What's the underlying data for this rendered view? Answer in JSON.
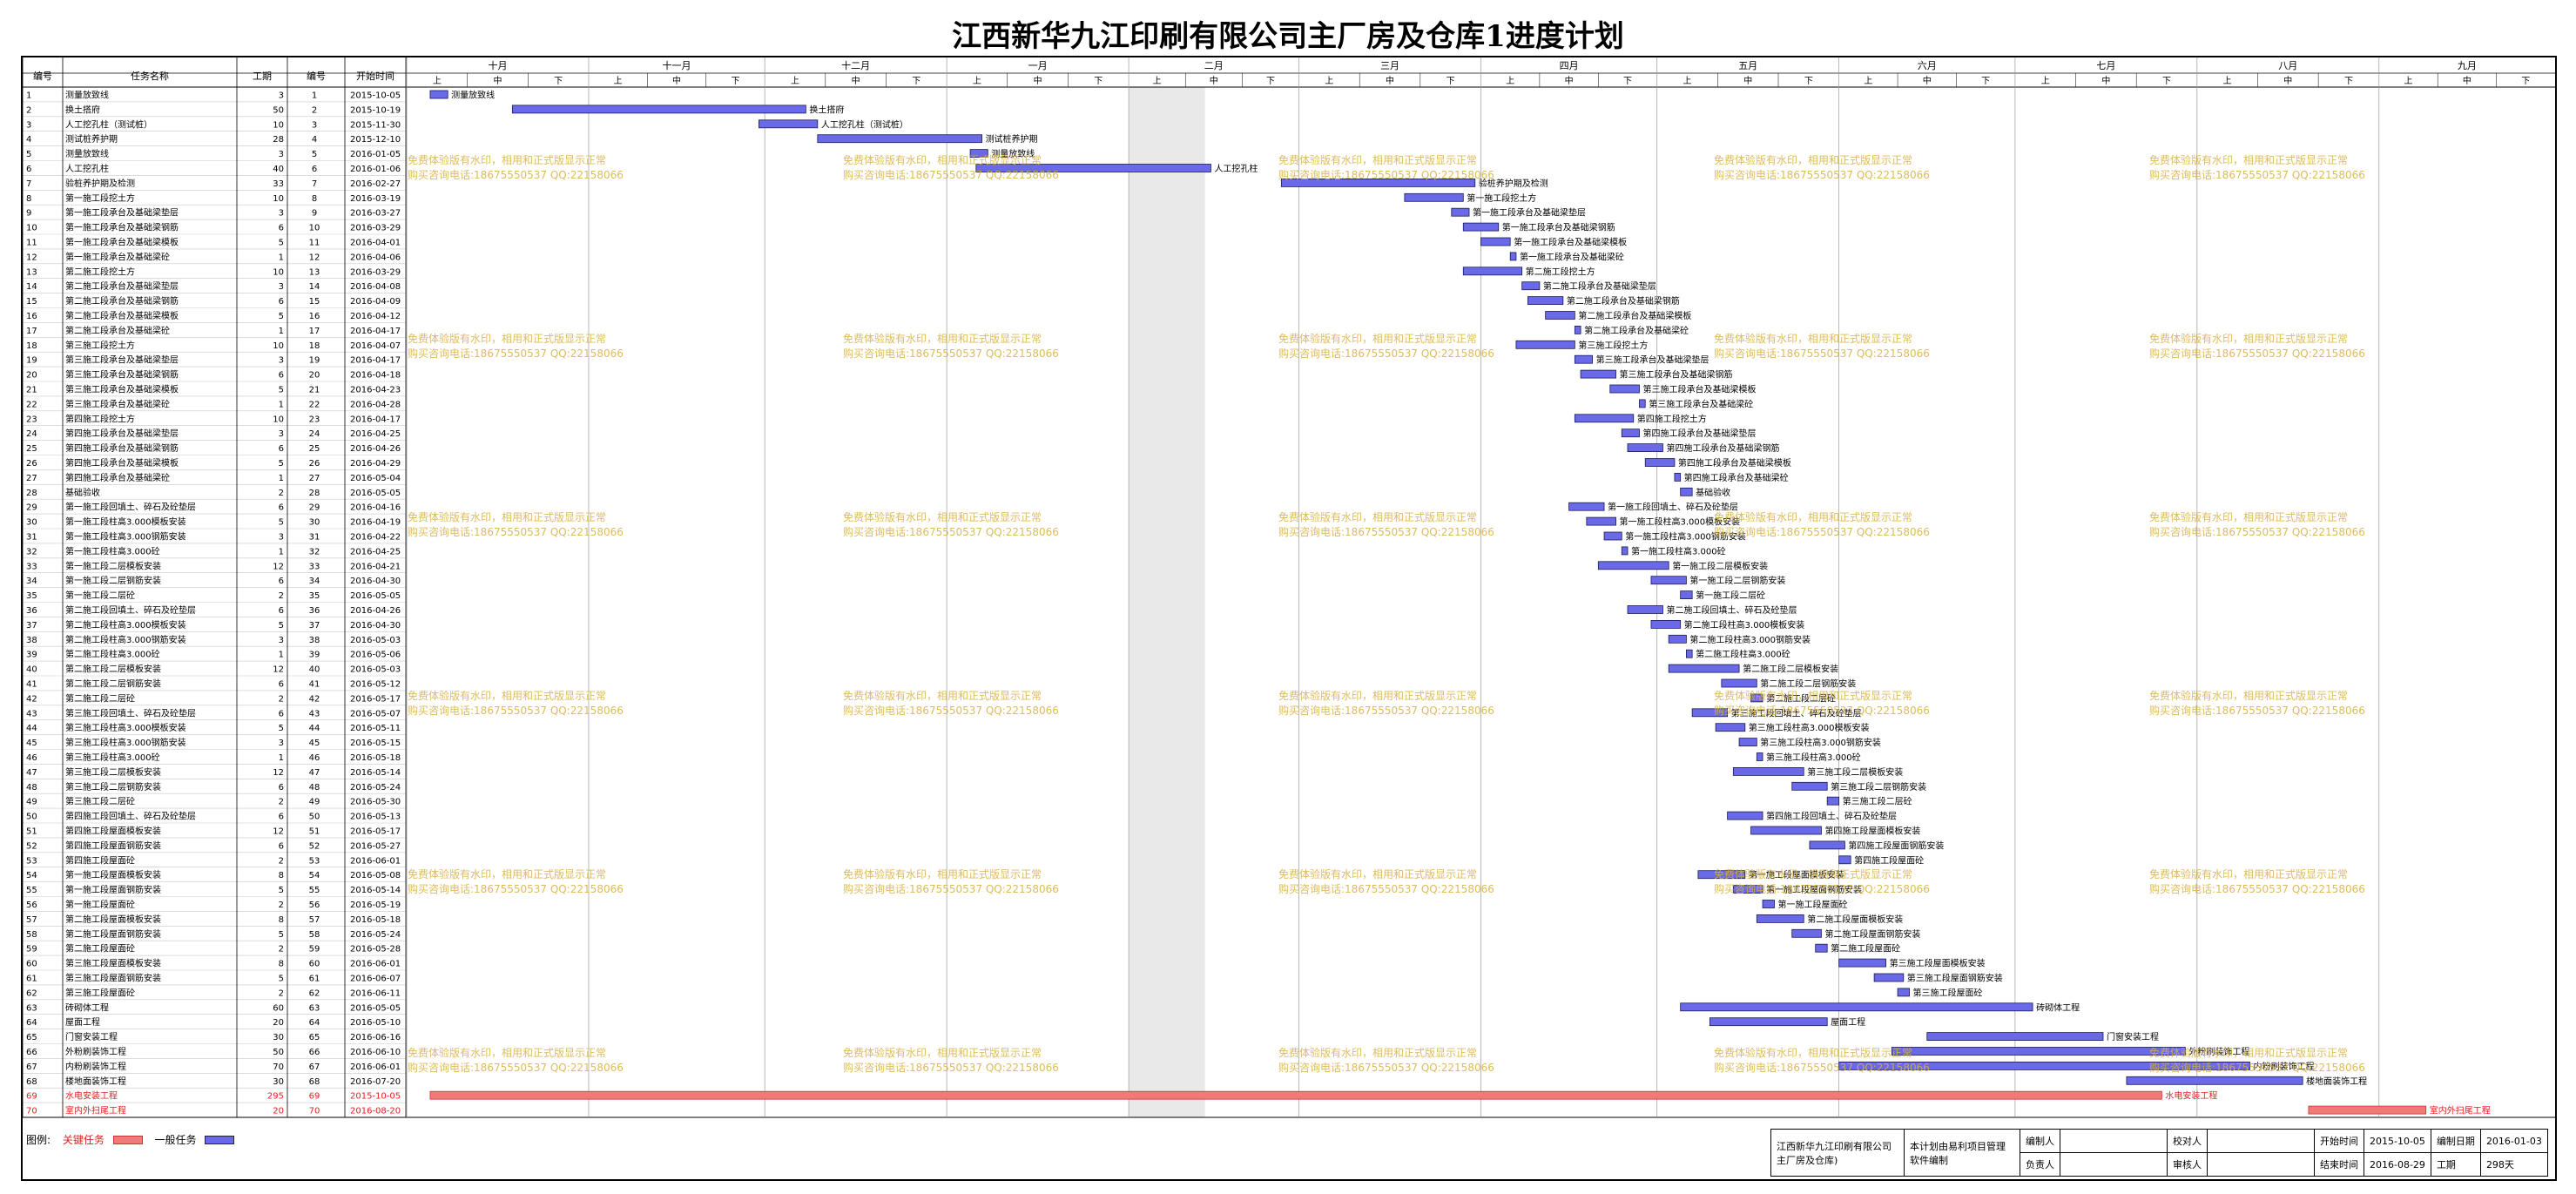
{
  "title": "江西新华九江印刷有限公司主厂房及仓库1进度计划",
  "headers": {
    "no": "编号",
    "name": "任务名称",
    "dur": "工期",
    "id": "编号",
    "start": "开始时间"
  },
  "months": [
    "十月",
    "十一月",
    "十二月",
    "一月",
    "二月",
    "三月",
    "四月",
    "五月",
    "六月",
    "七月",
    "八月",
    "九月"
  ],
  "periods": [
    "上",
    "下",
    "中"
  ],
  "watermark": {
    "line1": "免费体验版有水印，相用和正式版显示正常",
    "line2": "购买咨询电话:18675550537 QQ:22158066"
  },
  "legend": {
    "label": "图例:",
    "critical": "关键任务",
    "normal": "一般任务",
    "critical_color": "#f07a78",
    "normal_color": "#6a6ae8"
  },
  "info": {
    "company": "江西新华九江印刷有限公司主厂房及仓库)",
    "tool": "本计划由易利项目管理软件编制",
    "prepared_by": "编制人",
    "checked_by": "校对人",
    "owner": "负责人",
    "reviewer": "审核人",
    "start_label": "开始时间",
    "start": "2015-10-05",
    "date_label": "编制日期",
    "date": "2016-01-03",
    "end_label": "结束时间",
    "end": "2016-08-29",
    "dur_label": "工期",
    "dur": "298天"
  },
  "chart_data": {
    "type": "gantt",
    "title": "江西新华九江印刷有限公司主厂房及仓库1进度计划",
    "x_start": "2015-10-01",
    "x_end": "2016-09-30",
    "tasks": [
      {
        "no": "1",
        "name": "测量放致线",
        "dur": "3",
        "id": "1",
        "start": "2015-10-05"
      },
      {
        "no": "2",
        "name": "换土搭府",
        "dur": "50",
        "id": "2",
        "start": "2015-10-19"
      },
      {
        "no": "3",
        "name": "人工挖孔柱（测试桩）",
        "dur": "10",
        "id": "3",
        "start": "2015-11-30"
      },
      {
        "no": "4",
        "name": "测试桩养护期",
        "dur": "28",
        "id": "4",
        "start": "2015-12-10"
      },
      {
        "no": "5",
        "name": "测量放致线",
        "dur": "3",
        "id": "5",
        "start": "2016-01-05"
      },
      {
        "no": "6",
        "name": "人工挖孔柱",
        "dur": "40",
        "id": "6",
        "start": "2016-01-06"
      },
      {
        "no": "7",
        "name": "验桩养护期及检测",
        "dur": "33",
        "id": "7",
        "start": "2016-02-27"
      },
      {
        "no": "8",
        "name": "第一施工段挖土方",
        "dur": "10",
        "id": "8",
        "start": "2016-03-19"
      },
      {
        "no": "9",
        "name": "第一施工段承台及基础梁垫层",
        "dur": "3",
        "id": "9",
        "start": "2016-03-27"
      },
      {
        "no": "10",
        "name": "第一施工段承台及基础梁钢筋",
        "dur": "6",
        "id": "10",
        "start": "2016-03-29"
      },
      {
        "no": "11",
        "name": "第一施工段承台及基础梁模板",
        "dur": "5",
        "id": "11",
        "start": "2016-04-01"
      },
      {
        "no": "12",
        "name": "第一施工段承台及基础梁砼",
        "dur": "1",
        "id": "12",
        "start": "2016-04-06"
      },
      {
        "no": "13",
        "name": "第二施工段挖土方",
        "dur": "10",
        "id": "13",
        "start": "2016-03-29"
      },
      {
        "no": "14",
        "name": "第二施工段承台及基础梁垫层",
        "dur": "3",
        "id": "14",
        "start": "2016-04-08"
      },
      {
        "no": "15",
        "name": "第二施工段承台及基础梁钢筋",
        "dur": "6",
        "id": "15",
        "start": "2016-04-09"
      },
      {
        "no": "16",
        "name": "第二施工段承台及基础梁模板",
        "dur": "5",
        "id": "16",
        "start": "2016-04-12"
      },
      {
        "no": "17",
        "name": "第二施工段承台及基础梁砼",
        "dur": "1",
        "id": "17",
        "start": "2016-04-17"
      },
      {
        "no": "18",
        "name": "第三施工段挖土方",
        "dur": "10",
        "id": "18",
        "start": "2016-04-07"
      },
      {
        "no": "19",
        "name": "第三施工段承台及基础梁垫层",
        "dur": "3",
        "id": "19",
        "start": "2016-04-17"
      },
      {
        "no": "20",
        "name": "第三施工段承台及基础梁钢筋",
        "dur": "6",
        "id": "20",
        "start": "2016-04-18"
      },
      {
        "no": "21",
        "name": "第三施工段承台及基础梁模板",
        "dur": "5",
        "id": "21",
        "start": "2016-04-23"
      },
      {
        "no": "22",
        "name": "第三施工段承台及基础梁砼",
        "dur": "1",
        "id": "22",
        "start": "2016-04-28"
      },
      {
        "no": "23",
        "name": "第四施工段挖土方",
        "dur": "10",
        "id": "23",
        "start": "2016-04-17"
      },
      {
        "no": "24",
        "name": "第四施工段承台及基础梁垫层",
        "dur": "3",
        "id": "24",
        "start": "2016-04-25"
      },
      {
        "no": "25",
        "name": "第四施工段承台及基础梁钢筋",
        "dur": "6",
        "id": "25",
        "start": "2016-04-26"
      },
      {
        "no": "26",
        "name": "第四施工段承台及基础梁模板",
        "dur": "5",
        "id": "26",
        "start": "2016-04-29"
      },
      {
        "no": "27",
        "name": "第四施工段承台及基础梁砼",
        "dur": "1",
        "id": "27",
        "start": "2016-05-04"
      },
      {
        "no": "28",
        "name": "基础验收",
        "dur": "2",
        "id": "28",
        "start": "2016-05-05"
      },
      {
        "no": "29",
        "name": "第一施工段回填土、碎石及砼垫层",
        "dur": "6",
        "id": "29",
        "start": "2016-04-16"
      },
      {
        "no": "30",
        "name": "第一施工段柱高3.000模板安装",
        "dur": "5",
        "id": "30",
        "start": "2016-04-19"
      },
      {
        "no": "31",
        "name": "第一施工段柱高3.000钢筋安装",
        "dur": "3",
        "id": "31",
        "start": "2016-04-22"
      },
      {
        "no": "32",
        "name": "第一施工段柱高3.000砼",
        "dur": "1",
        "id": "32",
        "start": "2016-04-25"
      },
      {
        "no": "33",
        "name": "第一施工段二层模板安装",
        "dur": "12",
        "id": "33",
        "start": "2016-04-21"
      },
      {
        "no": "34",
        "name": "第一施工段二层钢筋安装",
        "dur": "6",
        "id": "34",
        "start": "2016-04-30"
      },
      {
        "no": "35",
        "name": "第一施工段二层砼",
        "dur": "2",
        "id": "35",
        "start": "2016-05-05"
      },
      {
        "no": "36",
        "name": "第二施工段回填土、碎石及砼垫层",
        "dur": "6",
        "id": "36",
        "start": "2016-04-26"
      },
      {
        "no": "37",
        "name": "第二施工段柱高3.000模板安装",
        "dur": "5",
        "id": "37",
        "start": "2016-04-30"
      },
      {
        "no": "38",
        "name": "第二施工段柱高3.000钢筋安装",
        "dur": "3",
        "id": "38",
        "start": "2016-05-03"
      },
      {
        "no": "39",
        "name": "第二施工段柱高3.000砼",
        "dur": "1",
        "id": "39",
        "start": "2016-05-06"
      },
      {
        "no": "40",
        "name": "第二施工段二层模板安装",
        "dur": "12",
        "id": "40",
        "start": "2016-05-03"
      },
      {
        "no": "41",
        "name": "第二施工段二层钢筋安装",
        "dur": "6",
        "id": "41",
        "start": "2016-05-12"
      },
      {
        "no": "42",
        "name": "第二施工段二层砼",
        "dur": "2",
        "id": "42",
        "start": "2016-05-17"
      },
      {
        "no": "43",
        "name": "第三施工段回填土、碎石及砼垫层",
        "dur": "6",
        "id": "43",
        "start": "2016-05-07"
      },
      {
        "no": "44",
        "name": "第三施工段柱高3.000模板安装",
        "dur": "5",
        "id": "44",
        "start": "2016-05-11"
      },
      {
        "no": "45",
        "name": "第三施工段柱高3.000钢筋安装",
        "dur": "3",
        "id": "45",
        "start": "2016-05-15"
      },
      {
        "no": "46",
        "name": "第三施工段柱高3.000砼",
        "dur": "1",
        "id": "46",
        "start": "2016-05-18"
      },
      {
        "no": "47",
        "name": "第三施工段二层模板安装",
        "dur": "12",
        "id": "47",
        "start": "2016-05-14"
      },
      {
        "no": "48",
        "name": "第三施工段二层钢筋安装",
        "dur": "6",
        "id": "48",
        "start": "2016-05-24"
      },
      {
        "no": "49",
        "name": "第三施工段二层砼",
        "dur": "2",
        "id": "49",
        "start": "2016-05-30"
      },
      {
        "no": "50",
        "name": "第四施工段回填土、碎石及砼垫层",
        "dur": "6",
        "id": "50",
        "start": "2016-05-13"
      },
      {
        "no": "51",
        "name": "第四施工段屋面模板安装",
        "dur": "12",
        "id": "51",
        "start": "2016-05-17"
      },
      {
        "no": "52",
        "name": "第四施工段屋面钢筋安装",
        "dur": "6",
        "id": "52",
        "start": "2016-05-27"
      },
      {
        "no": "53",
        "name": "第四施工段屋面砼",
        "dur": "2",
        "id": "53",
        "start": "2016-06-01"
      },
      {
        "no": "54",
        "name": "第一施工段屋面模板安装",
        "dur": "8",
        "id": "54",
        "start": "2016-05-08"
      },
      {
        "no": "55",
        "name": "第一施工段屋面钢筋安装",
        "dur": "5",
        "id": "55",
        "start": "2016-05-14"
      },
      {
        "no": "56",
        "name": "第一施工段屋面砼",
        "dur": "2",
        "id": "56",
        "start": "2016-05-19"
      },
      {
        "no": "57",
        "name": "第二施工段屋面模板安装",
        "dur": "8",
        "id": "57",
        "start": "2016-05-18"
      },
      {
        "no": "58",
        "name": "第二施工段屋面钢筋安装",
        "dur": "5",
        "id": "58",
        "start": "2016-05-24"
      },
      {
        "no": "59",
        "name": "第二施工段屋面砼",
        "dur": "2",
        "id": "59",
        "start": "2016-05-28"
      },
      {
        "no": "60",
        "name": "第三施工段屋面模板安装",
        "dur": "8",
        "id": "60",
        "start": "2016-06-01"
      },
      {
        "no": "61",
        "name": "第三施工段屋面钢筋安装",
        "dur": "5",
        "id": "61",
        "start": "2016-06-07"
      },
      {
        "no": "62",
        "name": "第三施工段屋面砼",
        "dur": "2",
        "id": "62",
        "start": "2016-06-11"
      },
      {
        "no": "63",
        "name": "砖砌体工程",
        "dur": "60",
        "id": "63",
        "start": "2016-05-05"
      },
      {
        "no": "64",
        "name": "屋面工程",
        "dur": "20",
        "id": "64",
        "start": "2016-05-10"
      },
      {
        "no": "65",
        "name": "门窗安装工程",
        "dur": "30",
        "id": "65",
        "start": "2016-06-16"
      },
      {
        "no": "66",
        "name": "外粉刷装饰工程",
        "dur": "50",
        "id": "66",
        "start": "2016-06-10"
      },
      {
        "no": "67",
        "name": "内粉刷装饰工程",
        "dur": "70",
        "id": "67",
        "start": "2016-06-01"
      },
      {
        "no": "68",
        "name": "楼地面装饰工程",
        "dur": "30",
        "id": "68",
        "start": "2016-07-20"
      },
      {
        "no": "69",
        "name": "水电安装工程",
        "dur": "295",
        "id": "69",
        "start": "2015-10-05",
        "critical": true
      },
      {
        "no": "70",
        "name": "室内外扫尾工程",
        "dur": "20",
        "id": "70",
        "start": "2016-08-20",
        "critical": true
      }
    ]
  }
}
